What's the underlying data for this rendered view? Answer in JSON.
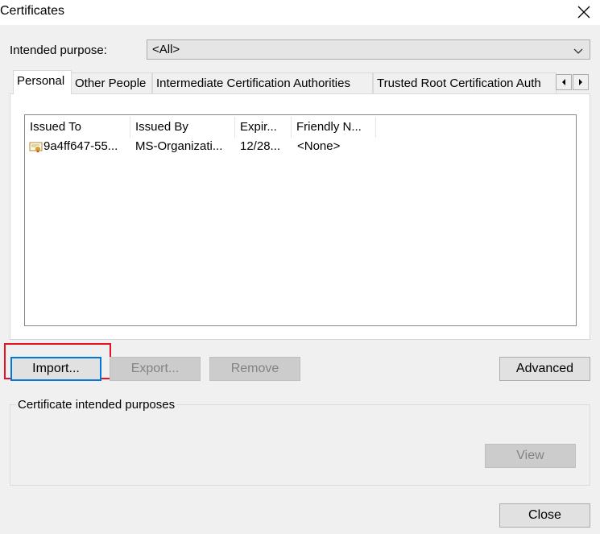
{
  "window": {
    "title": "Certificates"
  },
  "purpose": {
    "label": "Intended purpose:",
    "value": "<All>"
  },
  "tabs": [
    {
      "label": "Personal"
    },
    {
      "label": "Other People"
    },
    {
      "label": "Intermediate Certification Authorities"
    },
    {
      "label": "Trusted Root Certification Auth"
    }
  ],
  "list": {
    "columns": [
      "Issued To",
      "Issued By",
      "Expir...",
      "Friendly N..."
    ],
    "rows": [
      {
        "issued_to": "9a4ff647-55...",
        "issued_by": "MS-Organizati...",
        "expiration": "12/28...",
        "friendly_name": "<None>"
      }
    ]
  },
  "buttons": {
    "import": "Import...",
    "export": "Export...",
    "remove": "Remove",
    "advanced": "Advanced",
    "view": "View",
    "close": "Close"
  },
  "purposes_group": {
    "label": "Certificate intended purposes"
  },
  "colors": {
    "accent": "#0078d7",
    "highlight": "#e81123"
  }
}
